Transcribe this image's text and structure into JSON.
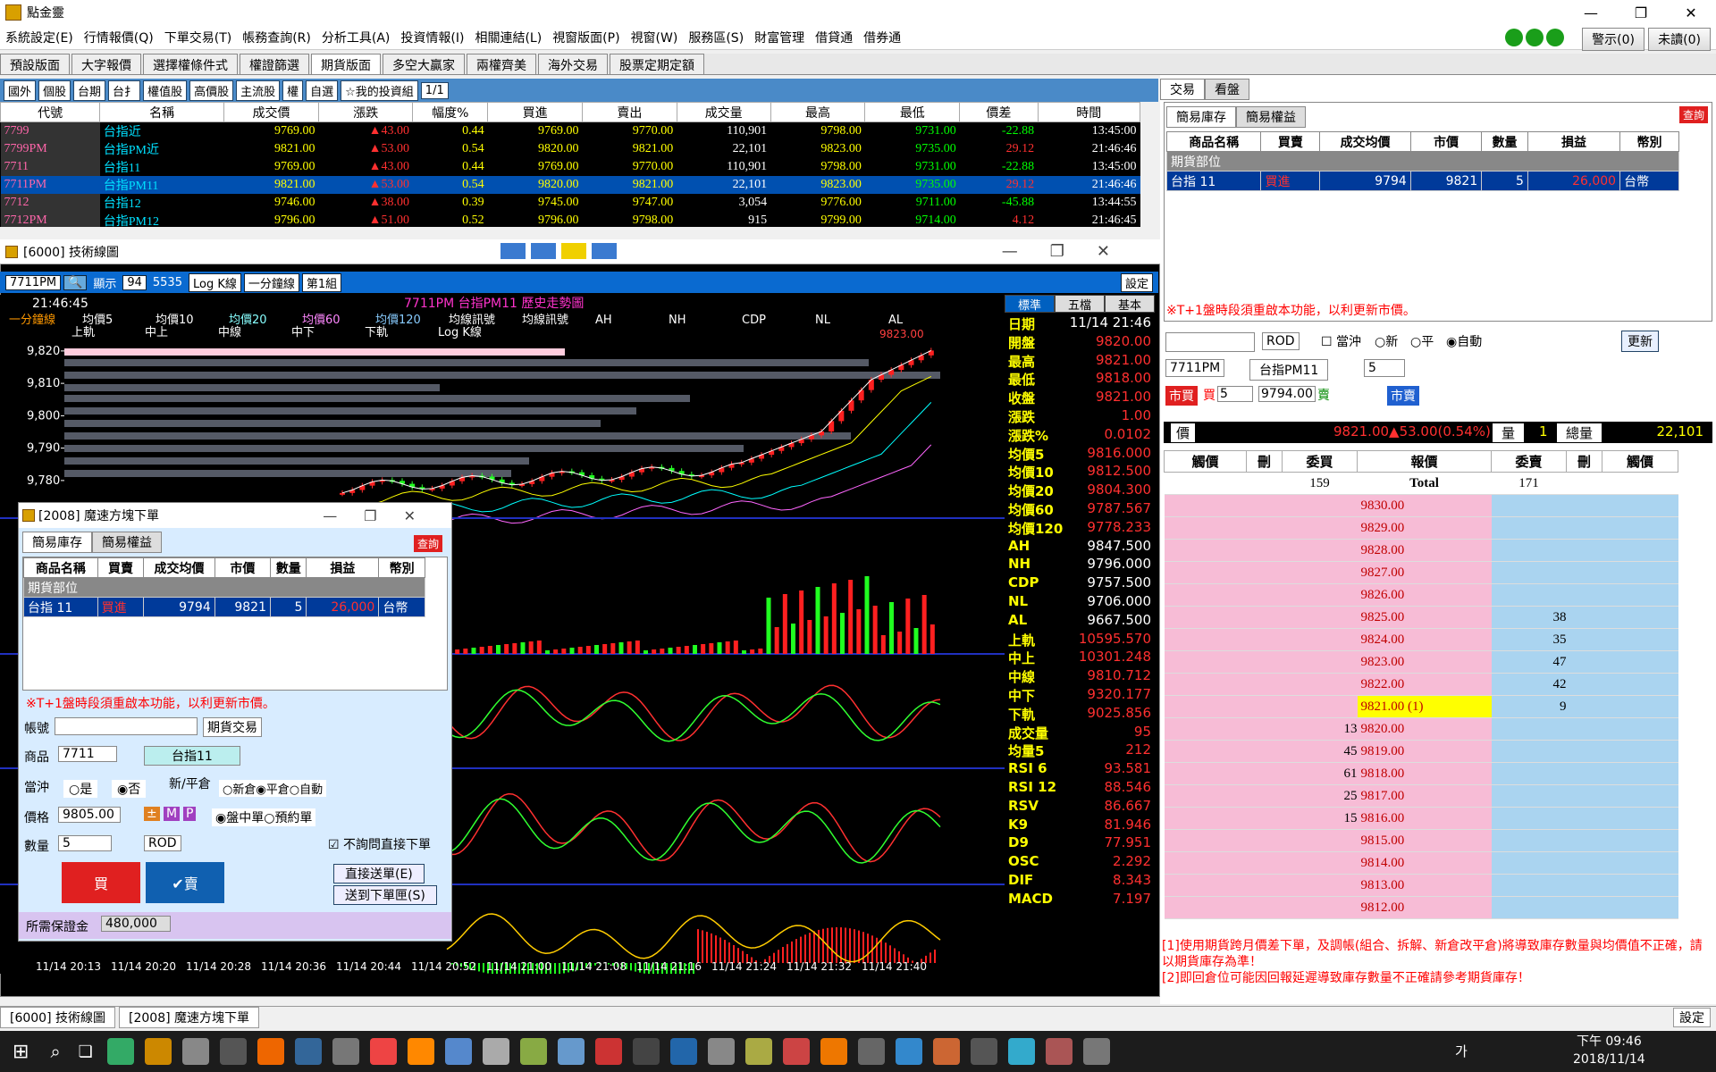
{
  "app": {
    "title": "點金靈",
    "window_buttons": [
      "—",
      "❐",
      "✕"
    ]
  },
  "menu": [
    "系統設定(E)",
    "行情報價(Q)",
    "下單交易(T)",
    "帳務查詢(R)",
    "分析工具(A)",
    "投資情報(I)",
    "相關連結(L)",
    "視窗版面(P)",
    "視窗(W)",
    "服務區(S)",
    "財富管理",
    "借貸通",
    "借券通"
  ],
  "top_buttons": {
    "alert": "警示(0)",
    "unread": "未讀(0)"
  },
  "tabs": [
    "預設版面",
    "大字報價",
    "選擇權條件式",
    "權證篩選",
    "期貨版面",
    "多空大贏家",
    "兩權齊美",
    "海外交易",
    "股票定期定額"
  ],
  "active_tab": "期貨版面",
  "quote_toolbar": [
    "國外",
    "個股",
    "台期",
    "台扌",
    "權值股",
    "高價股",
    "主流股",
    "權",
    "自選",
    "☆我的投資組",
    "1/1"
  ],
  "quote_headers": [
    "代號",
    "名稱",
    "成交價",
    "漲跌",
    "幅度%",
    "買進",
    "賣出",
    "成交量",
    "最高",
    "最低",
    "價差",
    "時間"
  ],
  "quote_rows": [
    {
      "code": "7799",
      "name": "台指近",
      "price": "9769.00",
      "chg": "▲43.00",
      "pct": "0.44",
      "bid": "9769.00",
      "ask": "9770.00",
      "vol": "110,901",
      "high": "9798.00",
      "low": "9731.00",
      "spread": "-22.88",
      "time": "13:45:00"
    },
    {
      "code": "7799PM",
      "name": "台指PM近",
      "price": "9821.00",
      "chg": "▲53.00",
      "pct": "0.54",
      "bid": "9820.00",
      "ask": "9821.00",
      "vol": "22,101",
      "high": "9823.00",
      "low": "9735.00",
      "spread": "29.12",
      "time": "21:46:46"
    },
    {
      "code": "7711",
      "name": "台指11",
      "price": "9769.00",
      "chg": "▲43.00",
      "pct": "0.44",
      "bid": "9769.00",
      "ask": "9770.00",
      "vol": "110,901",
      "high": "9798.00",
      "low": "9731.00",
      "spread": "-22.88",
      "time": "13:45:00"
    },
    {
      "code": "7711PM",
      "name": "台指PM11",
      "price": "9821.00",
      "chg": "▲53.00",
      "pct": "0.54",
      "bid": "9820.00",
      "ask": "9821.00",
      "vol": "22,101",
      "high": "9823.00",
      "low": "9735.00",
      "spread": "29.12",
      "time": "21:46:46"
    },
    {
      "code": "7712",
      "name": "台指12",
      "price": "9746.00",
      "chg": "▲38.00",
      "pct": "0.39",
      "bid": "9745.00",
      "ask": "9747.00",
      "vol": "3,054",
      "high": "9776.00",
      "low": "9711.00",
      "spread": "-45.88",
      "time": "13:44:55"
    },
    {
      "code": "7712PM",
      "name": "台指PM12",
      "price": "9796.00",
      "chg": "▲51.00",
      "pct": "0.52",
      "bid": "9796.00",
      "ask": "9798.00",
      "vol": "915",
      "high": "9799.00",
      "low": "9714.00",
      "spread": "4.12",
      "time": "21:46:45"
    }
  ],
  "chart_window": {
    "title": "[6000] 技術線圖",
    "symbol": "7711PM",
    "display_label": "顯示",
    "display_count": "94",
    "total": "5535",
    "kline": "Log K線",
    "period": "一分鐘線",
    "scheme": "第1組",
    "settings": "設定",
    "time": "21:46:45",
    "chart_title": "7711PM 台指PM11  歷史走勢圖",
    "legend": [
      "一分鐘線",
      "均價5",
      "均價10",
      "均價20",
      "均價60",
      "均價120",
      "均線訊號",
      "均線訊號",
      "AH",
      "NH",
      "CDP",
      "NL",
      "AL",
      "上軌",
      "中上",
      "中線",
      "中下",
      "下軌",
      "Log K線"
    ],
    "yticks": [
      "9,820",
      "9,810",
      "9,800",
      "9,790",
      "9,780"
    ],
    "xticks": [
      "11/14 20:13",
      "11/14 20:20",
      "11/14 20:28",
      "11/14 20:36",
      "11/14 20:44",
      "11/14 20:52",
      "11/14 21:00",
      "11/14 21:08",
      "11/14 21:16",
      "11/14 21:24",
      "11/14 21:32",
      "11/14 21:40"
    ],
    "high_label": "9823.00",
    "side_tabs": [
      "標準",
      "五檔",
      "基本"
    ]
  },
  "indicators": [
    {
      "k": "日期",
      "v": "11/14 21:46",
      "up": false
    },
    {
      "k": "開盤",
      "v": "9820.00",
      "up": true
    },
    {
      "k": "最高",
      "v": "9821.00",
      "up": true
    },
    {
      "k": "最低",
      "v": "9818.00",
      "up": true
    },
    {
      "k": "收盤",
      "v": "9821.00",
      "up": true
    },
    {
      "k": "漲跌",
      "v": "1.00",
      "up": true
    },
    {
      "k": "漲跌%",
      "v": "0.0102",
      "up": true
    },
    {
      "k": "均價5",
      "v": "9816.000",
      "up": true
    },
    {
      "k": "均價10",
      "v": "9812.500",
      "up": true
    },
    {
      "k": "均價20",
      "v": "9804.300",
      "up": true
    },
    {
      "k": "均價60",
      "v": "9787.567",
      "up": true
    },
    {
      "k": "均價120",
      "v": "9778.233",
      "up": true
    },
    {
      "k": "AH",
      "v": "9847.500",
      "up": false
    },
    {
      "k": "NH",
      "v": "9796.000",
      "up": false
    },
    {
      "k": "CDP",
      "v": "9757.500",
      "up": false
    },
    {
      "k": "NL",
      "v": "9706.000",
      "up": false
    },
    {
      "k": "AL",
      "v": "9667.500",
      "up": false
    },
    {
      "k": "上軌",
      "v": "10595.570",
      "up": true
    },
    {
      "k": "中上",
      "v": "10301.248",
      "up": true
    },
    {
      "k": "中線",
      "v": "9810.712",
      "up": true
    },
    {
      "k": "中下",
      "v": "9320.177",
      "up": true
    },
    {
      "k": "下軌",
      "v": "9025.856",
      "up": true
    },
    {
      "k": "成交量",
      "v": "95",
      "up": true
    },
    {
      "k": "均量5",
      "v": "212",
      "up": true
    },
    {
      "k": "RSI 6",
      "v": "93.581",
      "up": true
    },
    {
      "k": "RSI 12",
      "v": "88.546",
      "up": true
    },
    {
      "k": "RSV",
      "v": "86.667",
      "up": true
    },
    {
      "k": "K9",
      "v": "81.946",
      "up": true
    },
    {
      "k": "D9",
      "v": "77.951",
      "up": true
    },
    {
      "k": "OSC",
      "v": "2.292",
      "up": true
    },
    {
      "k": "DIF",
      "v": "8.343",
      "up": true
    },
    {
      "k": "MACD",
      "v": "7.197",
      "up": true
    }
  ],
  "right": {
    "tabs": [
      "交易",
      "看盤"
    ],
    "subtabs": [
      "簡易庫存",
      "簡易權益"
    ],
    "query": "查詢",
    "inv_headers": [
      "商品名稱",
      "買賣",
      "成交均價",
      "市價",
      "數量",
      "損益",
      "幣別"
    ],
    "inv_group": "期貨部位",
    "inv_row": [
      "台指 11",
      "買進",
      "9794",
      "9821",
      "5",
      "26,000",
      "台幣"
    ],
    "notice": "※T+1盤時段須重啟本功能，以利更新市價。",
    "order_type": "ROD",
    "chk_offset": "當沖",
    "opts": [
      "新",
      "平",
      "自動"
    ],
    "update": "更新",
    "symbol": "7711PM",
    "symbol_name": "台指PM11",
    "qty": "5",
    "mkt_buy": "市買",
    "buy_label": "買",
    "buy_qty": "5",
    "buy_price": "9794.00",
    "sell_label": "賣",
    "mkt_sell": "市賣",
    "price_label": "價",
    "price_info": "9821.00▲53.00(0.54%)",
    "vol_label": "量",
    "vol_val": "1",
    "total_label": "總量",
    "total_val": "22,101",
    "dom_headers": [
      "觸價",
      "刪",
      "委買",
      "報價",
      "委賣",
      "刪",
      "觸價"
    ],
    "dom_totals": [
      "159",
      "Total",
      "171"
    ],
    "dom_rows": [
      {
        "bid": "",
        "price": "9830.00",
        "ask": ""
      },
      {
        "bid": "",
        "price": "9829.00",
        "ask": ""
      },
      {
        "bid": "",
        "price": "9828.00",
        "ask": ""
      },
      {
        "bid": "",
        "price": "9827.00",
        "ask": ""
      },
      {
        "bid": "",
        "price": "9826.00",
        "ask": ""
      },
      {
        "bid": "",
        "price": "9825.00",
        "ask": "38"
      },
      {
        "bid": "",
        "price": "9824.00",
        "ask": "35"
      },
      {
        "bid": "",
        "price": "9823.00",
        "ask": "47"
      },
      {
        "bid": "",
        "price": "9822.00",
        "ask": "42"
      },
      {
        "bid": "",
        "price": "9821.00 (1)",
        "ask": "9"
      },
      {
        "bid": "13",
        "price": "9820.00",
        "ask": ""
      },
      {
        "bid": "45",
        "price": "9819.00",
        "ask": ""
      },
      {
        "bid": "61",
        "price": "9818.00",
        "ask": ""
      },
      {
        "bid": "25",
        "price": "9817.00",
        "ask": ""
      },
      {
        "bid": "15",
        "price": "9816.00",
        "ask": ""
      },
      {
        "bid": "",
        "price": "9815.00",
        "ask": ""
      },
      {
        "bid": "",
        "price": "9814.00",
        "ask": ""
      },
      {
        "bid": "",
        "price": "9813.00",
        "ask": ""
      },
      {
        "bid": "",
        "price": "9812.00",
        "ask": ""
      }
    ],
    "warn1": "[1]使用期貨跨月價差下單，及調帳(組合、拆解、新倉改平倉)將導致庫存數量與均價值不正確，請以期貨庫存為準！",
    "warn2": "[2]即回倉位可能因回報延遲導致庫存數量不正確請參考期貨庫存！"
  },
  "order_window": {
    "title": "[2008] 魔速方塊下單",
    "subtabs": [
      "簡易庫存",
      "簡易權益"
    ],
    "query": "查詢",
    "account_label": "帳號",
    "trade_type": "期貨交易",
    "product_label": "商品",
    "product_code": "7711",
    "product_name": "台指11",
    "offset_label": "當沖",
    "offset_opts": [
      "是",
      "否"
    ],
    "open_label": "新/平倉",
    "open_opts": [
      "新倉",
      "平倉",
      "自動"
    ],
    "price_label": "價格",
    "price": "9805.00",
    "session_opts": [
      "盤中單",
      "預約單"
    ],
    "qty_label": "數量",
    "qty": "5",
    "ord_type": "ROD",
    "no_confirm": "不詢問直接下單",
    "buy": "買",
    "sell": "✔賣",
    "direct": "直接送單(E)",
    "to_box": "送到下單匣(S)",
    "margin_label": "所需保證金",
    "margin": "480,000"
  },
  "bottom_tabs": [
    "[6000] 技術線圖",
    "[2008] 魔速方塊下單"
  ],
  "bottom_right": "設定",
  "clock": {
    "time": "下午 09:46",
    "date": "2018/11/14"
  },
  "ime": "가"
}
